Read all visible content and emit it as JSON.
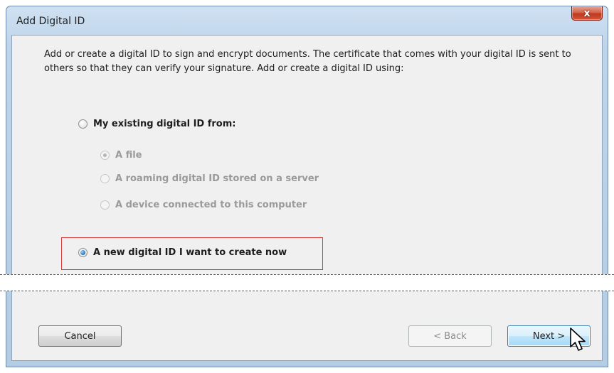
{
  "window": {
    "title": "Add Digital ID",
    "close_glyph": "x"
  },
  "intro_text": "Add or create a digital ID to sign and encrypt documents. The certificate that comes with your digital ID is sent to others so that they can verify your signature. Add or create a digital ID using:",
  "options": {
    "existing": {
      "label": "My existing digital ID from:",
      "selected": false
    },
    "sub_options": [
      {
        "label": "A file",
        "selected": true,
        "disabled": true
      },
      {
        "label": "A roaming digital ID stored on a server",
        "selected": false,
        "disabled": true
      },
      {
        "label": "A device connected to this computer",
        "selected": false,
        "disabled": true
      }
    ],
    "new": {
      "label": "A new digital ID I want to create now",
      "selected": true
    }
  },
  "buttons": {
    "cancel": "Cancel",
    "back": "< Back",
    "next": "Next >"
  },
  "colors": {
    "highlight": "#d43a3a",
    "accent": "#3c7fb1"
  },
  "icons": {
    "close": "close-icon",
    "cursor": "mouse-pointer-icon"
  }
}
